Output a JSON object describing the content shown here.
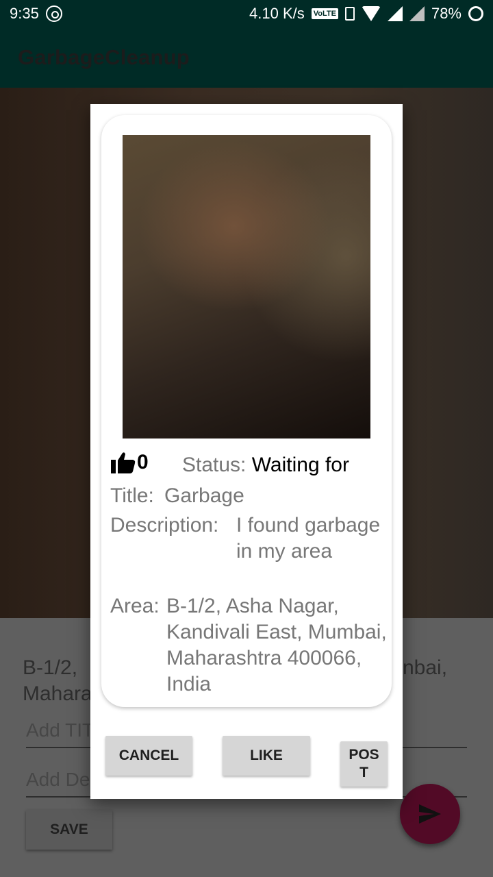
{
  "status_bar": {
    "time": "9:35",
    "speed": "4.10 K/s",
    "volte": "VoLTE",
    "battery": "78%"
  },
  "app": {
    "title": "GarbageCleanup"
  },
  "background_form": {
    "address_line1_left": "B-1/2,",
    "address_line1_right": "nbai,",
    "address_line2_left": "Mahara",
    "title_placeholder": "Add TIT",
    "desc_placeholder": "Add De",
    "save_label": "SAVE"
  },
  "dialog": {
    "likes": "0",
    "status_label": "Status: ",
    "status_value": "Waiting for",
    "title_label": "Title: ",
    "title_value": "Garbage",
    "description_label": "Description:",
    "description_value": "I found garbage in my area",
    "area_label": "Area:",
    "area_value": "B-1/2, Asha Nagar, Kandivali East, Mumbai, Maharashtra 400066, India",
    "buttons": {
      "cancel": "CANCEL",
      "like": "LIKE",
      "post": "POST"
    }
  },
  "icons": {
    "thumbs_up": "thumbs-up-icon",
    "send": "send-icon",
    "whatsapp": "whatsapp-icon"
  },
  "colors": {
    "app_bar": "#002b26",
    "fab": "#520a26",
    "dialog_button": "#d6d6d6"
  }
}
